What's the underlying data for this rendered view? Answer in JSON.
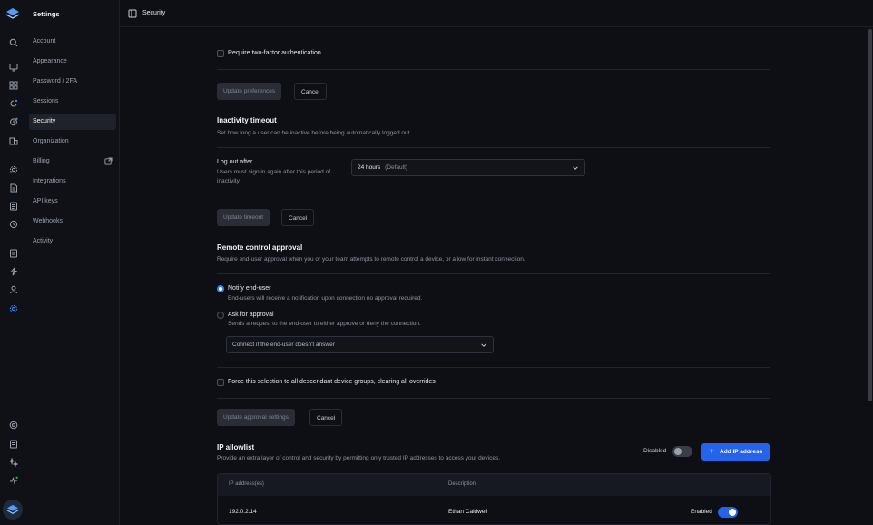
{
  "app": {
    "title": "Settings",
    "page_title": "Security"
  },
  "sidebar": {
    "items": [
      {
        "label": "Account"
      },
      {
        "label": "Appearance"
      },
      {
        "label": "Password / 2FA"
      },
      {
        "label": "Sessions"
      },
      {
        "label": "Security"
      },
      {
        "label": "Organization"
      },
      {
        "label": "Billing"
      },
      {
        "label": "Integrations"
      },
      {
        "label": "API keys"
      },
      {
        "label": "Webhooks"
      },
      {
        "label": "Activity"
      }
    ],
    "active": "Security"
  },
  "two_factor": {
    "checkbox_label": "Require two-factor authentication",
    "checked": false,
    "update_label": "Update preferences",
    "cancel_label": "Cancel"
  },
  "inactivity": {
    "title": "Inactivity timeout",
    "description": "Set how long a user can be inactive before being automatically logged out.",
    "field_label": "Log out after",
    "field_help": "Users must sign in again after this period of inactivity.",
    "select_value": "24 hours",
    "select_suffix": "(Default)",
    "update_label": "Update timeout",
    "cancel_label": "Cancel"
  },
  "remote": {
    "title": "Remote control approval",
    "description": "Require end-user approval when you or your team attempts to remote control a device, or allow for instant connection.",
    "options": [
      {
        "label": "Notify end-user",
        "help": "End-users will receive a notification upon connection no approval required.",
        "selected": true
      },
      {
        "label": "Ask for approval",
        "help": "Sends a request to the end-user to either approve or deny the connection.",
        "selected": false
      }
    ],
    "fallback_select": "Connect if the end-user doesn't answer",
    "force_label": "Force this selection to all descendant device groups, clearing all overrides",
    "update_label": "Update approval settings",
    "cancel_label": "Cancel"
  },
  "ip_allowlist": {
    "title": "IP allowlist",
    "description": "Provide an extra layer of control and security by permitting only trusted IP addresses to access your devices.",
    "toggle_label": "Disabled",
    "toggle_on": false,
    "add_label": "Add IP address",
    "columns": [
      "IP address(es)",
      "Description"
    ],
    "rows": [
      {
        "ip": "192.0.2.14",
        "description": "Ethan Caldwell",
        "status": "Enabled",
        "enabled": true
      }
    ]
  },
  "colors": {
    "accent": "#2563eb",
    "background": "#0d0f14"
  }
}
